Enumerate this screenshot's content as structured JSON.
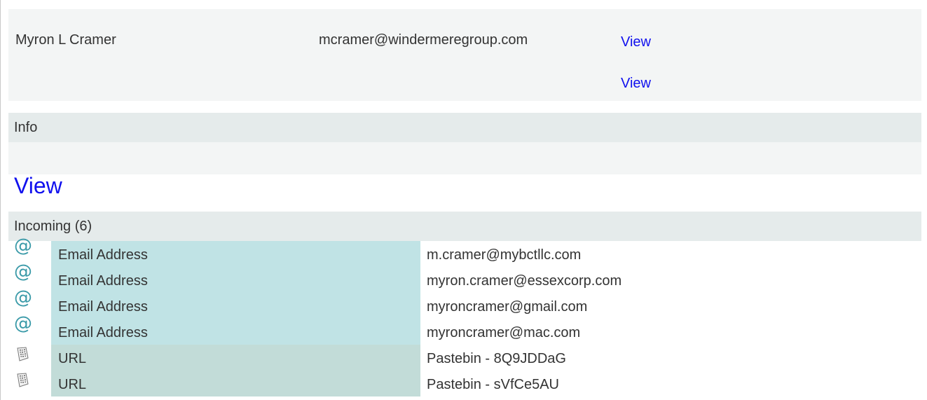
{
  "contact": {
    "name": "Myron L Cramer",
    "email": "mcramer@windermeregroup.com",
    "view_links": [
      "View",
      "View"
    ]
  },
  "info": {
    "header": "Info",
    "view_label": "View"
  },
  "incoming": {
    "header": "Incoming (6)",
    "rows": [
      {
        "icon": "at-sign-icon",
        "type": "Email Address",
        "value": "m.cramer@mybctllc.com"
      },
      {
        "icon": "at-sign-icon",
        "type": "Email Address",
        "value": "myron.cramer@essexcorp.com"
      },
      {
        "icon": "at-sign-icon",
        "type": "Email Address",
        "value": "myroncramer@gmail.com"
      },
      {
        "icon": "at-sign-icon",
        "type": "Email Address",
        "value": "myroncramer@mac.com"
      },
      {
        "icon": "binary-document-icon",
        "type": "URL",
        "value": "Pastebin - 8Q9JDDaG"
      },
      {
        "icon": "binary-document-icon",
        "type": "URL",
        "value": "Pastebin - sVfCe5AU"
      }
    ]
  },
  "colors": {
    "link": "#1010ee",
    "email_type_bg": "#c0e3e5",
    "url_type_bg": "#c2dcd8",
    "header_bg": "#e5ebeb",
    "panel_bg": "#f3f5f5",
    "at_icon": "#3a9aa8"
  }
}
